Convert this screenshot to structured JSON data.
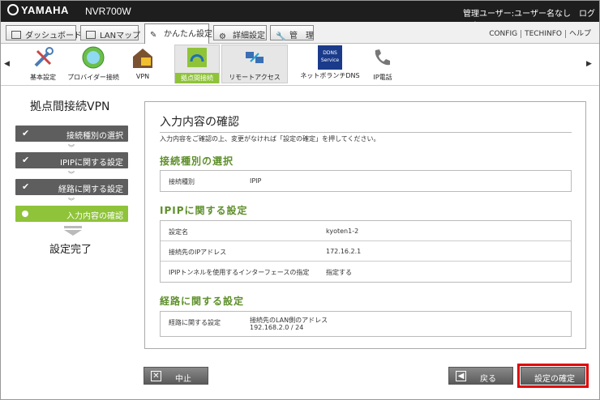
{
  "header": {
    "brand": "YAMAHA",
    "model": "NVR700W",
    "user": "管理ユーザー:ユーザー名なし",
    "logout": "ログアウト"
  },
  "menu": {
    "tabs": [
      {
        "label": "ダッシュボード"
      },
      {
        "label": "LANマップ"
      },
      {
        "label": "かんたん設定"
      },
      {
        "label": "詳細設定"
      },
      {
        "label": "管　理"
      }
    ],
    "links": [
      "CONFIG",
      "TECHINFO",
      "ヘルプ"
    ]
  },
  "icons": [
    "基本設定",
    "プロバイダー接続",
    "VPN",
    "拠点間接続",
    "リモートアクセス",
    "ネットボランチDNS",
    "IP電話"
  ],
  "ddns_icon_text": "DDNS Service",
  "nav": {
    "prev": "◀",
    "next": "▶"
  },
  "sidebar": {
    "title": "拠点間接続VPN",
    "steps": [
      "接続種別の選択",
      "IPIPに関する設定",
      "経路に関する設定",
      "入力内容の確認"
    ],
    "done": "設定完了"
  },
  "panel": {
    "title": "入力内容の確認",
    "desc": "入力内容をご確認の上、変更がなければ「設定の確定」を押してください。",
    "s1": {
      "heading": "接続種別の選択",
      "rows": [
        {
          "k": "接続種別",
          "v": "IPIP"
        }
      ]
    },
    "s2": {
      "heading": "IPIPに関する設定",
      "rows": [
        {
          "k": "設定名",
          "v": "kyoten1-2"
        },
        {
          "k": "接続先のIPアドレス",
          "v": "172.16.2.1"
        },
        {
          "k": "IPIPトンネルを使用するインターフェースの指定",
          "v": "指定する"
        }
      ]
    },
    "s3": {
      "heading": "経路に関する設定",
      "rows": [
        {
          "k": "経路に関する設定",
          "v": "接続先のLAN側のアドレス",
          "v2": "192.168.2.0 / 24"
        }
      ]
    }
  },
  "buttons": {
    "cancel": "中止",
    "back": "戻る",
    "confirm": "設定の確定"
  }
}
